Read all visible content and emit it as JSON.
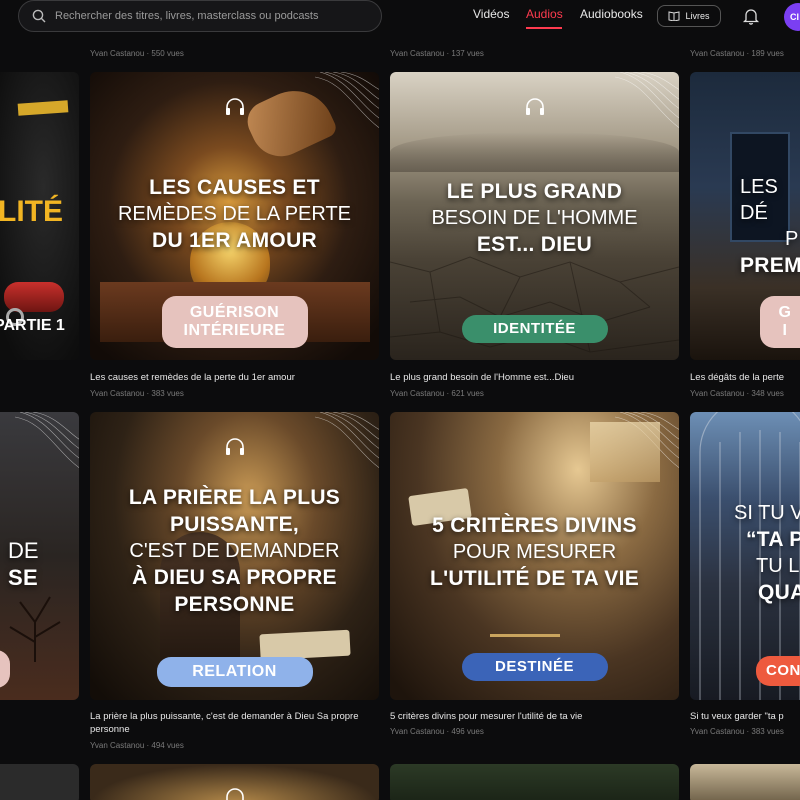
{
  "search": {
    "placeholder": "Rechercher des titres, livres, masterclass ou podcasts"
  },
  "nav": {
    "videos": "Vidéos",
    "audios": "Audios",
    "audiobooks": "Audiobooks",
    "livres": "Livres"
  },
  "user": {
    "initials": "CI"
  },
  "colors": {
    "accent": "#ff3b4f",
    "guerison": "#e6c3be",
    "identite": "#3a8f6b",
    "relation": "#8fb2ea",
    "destinee": "#3b64b8",
    "confiance": "#ee5a3e"
  },
  "top_meta": [
    {
      "author": "Yvan Castanou",
      "views": "550 vues"
    },
    {
      "author": "Yvan Castanou",
      "views": "137 vues"
    },
    {
      "author": "Yvan Castanou",
      "views": "189 vues"
    }
  ],
  "row1": [
    {
      "cover": {
        "line1": "LITÉ",
        "line2": "PARTIE 1"
      }
    },
    {
      "cover": {
        "l1": "LES CAUSES ET",
        "l2": "REMÈDES DE LA PERTE",
        "l3": "DU 1ER AMOUR"
      },
      "badge": "GUÉRISON\nINTÉRIEURE",
      "title": "Les causes et remèdes de la perte du 1er amour",
      "author": "Yvan Castanou",
      "views": "383 vues"
    },
    {
      "cover": {
        "l1": "LE PLUS GRAND",
        "l2": "BESOIN DE L'HOMME",
        "l3": "EST... DIEU"
      },
      "badge": "IDENTITÉE",
      "title": "Le plus grand besoin de l'Homme est...Dieu",
      "author": "Yvan Castanou",
      "views": "621 vues"
    },
    {
      "cover": {
        "l1": "LES DÉ",
        "l2": "P",
        "l3": "PREM"
      },
      "badge": "G\nI",
      "title": "Les dégâts de la perte",
      "author": "Yvan Castanou",
      "views": "348 vues"
    }
  ],
  "row2": [
    {
      "cover": {
        "l1": "DE",
        "l2": "SE"
      }
    },
    {
      "cover": {
        "l1": "LA PRIÈRE LA PLUS",
        "l2": "PUISSANTE,",
        "l3": "C'EST DE DEMANDER",
        "l4": "À DIEU SA PROPRE",
        "l5": "PERSONNE"
      },
      "badge": "RELATION",
      "title": "La prière la plus puissante, c'est de demander à Dieu Sa propre personne",
      "author": "Yvan Castanou",
      "views": "494 vues"
    },
    {
      "cover": {
        "l1": "5 CRITÈRES DIVINS",
        "l2": "POUR MESURER",
        "l3": "L'UTILITÉ DE TA VIE"
      },
      "badge": "DESTINÉE",
      "title": "5 critères divins pour mesurer l'utilité de ta vie",
      "author": "Yvan Castanou",
      "views": "496 vues"
    },
    {
      "cover": {
        "l1": "SI TU V",
        "l2": "“TA P",
        "l3": "TU L",
        "l4": "QUA"
      },
      "badge": "CON",
      "title": "Si tu veux garder \"ta p",
      "author": "Yvan Castanou",
      "views": "383 vues"
    }
  ]
}
